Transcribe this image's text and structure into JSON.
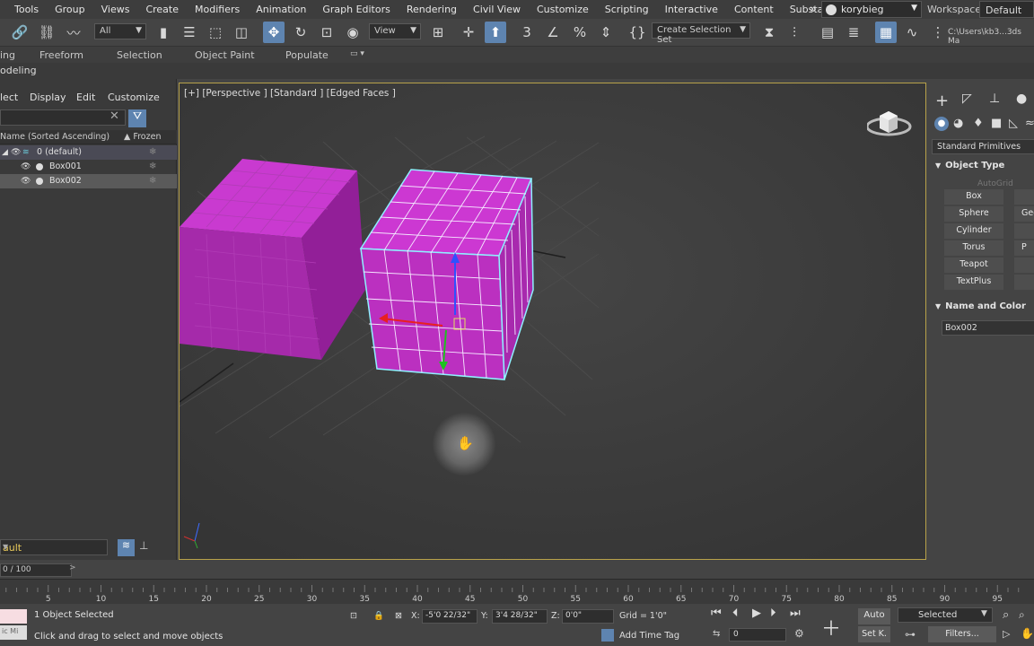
{
  "menubar": {
    "items": [
      "Tools",
      "Group",
      "Views",
      "Create",
      "Modifiers",
      "Animation",
      "Graph Editors",
      "Rendering",
      "Civil View",
      "Customize",
      "Scripting",
      "Interactive",
      "Content",
      "Substance"
    ],
    "more": "»",
    "user": "korybieg",
    "workspaces_label": "Workspaces:",
    "workspace_value": "Default"
  },
  "toolbar": {
    "selection_filter": "All",
    "ref_coord": "View",
    "selection_set": "Create Selection Set",
    "path": "C:\\Users\\kb3...3ds Ma"
  },
  "ribbon": {
    "tabs": [
      "ing",
      "Freeform",
      "Selection",
      "Object Paint",
      "Populate"
    ]
  },
  "modeling_bar": "odeling",
  "scene_explorer": {
    "menu": [
      "lect",
      "Display",
      "Edit",
      "Customize"
    ],
    "col_name": "Name (Sorted Ascending)",
    "col_frozen": "▲ Frozen",
    "rows": [
      {
        "name": "0 (default)"
      },
      {
        "name": "Box001"
      },
      {
        "name": "Box002"
      }
    ],
    "layer": "ault"
  },
  "viewport": {
    "label": "[+] [Perspective ] [Standard ] [Edged Faces ]"
  },
  "command_panel": {
    "category": "Standard Primitives",
    "object_type_title": "Object Type",
    "autogrid": "AutoGrid",
    "buttons": [
      "Box",
      "Sphere",
      "Cylinder",
      "Torus",
      "Teapot",
      "TextPlus"
    ],
    "buttons_right": [
      "",
      "Geo",
      "",
      "P",
      "",
      ""
    ],
    "name_color_title": "Name and Color",
    "name_value": "Box002"
  },
  "timeline": {
    "frame": "0 / 100",
    "ticks": [
      "5",
      "10",
      "15",
      "20",
      "25",
      "30",
      "35",
      "40",
      "45",
      "50",
      "55",
      "60",
      "65",
      "70",
      "75",
      "80",
      "85",
      "90",
      "95"
    ]
  },
  "status": {
    "selected": "1 Object Selected",
    "hint": "Click and drag to select and move objects",
    "mini": "ic Mi",
    "x_label": "X:",
    "x": "-5'0 22/32\"",
    "y_label": "Y:",
    "y": "3'4 28/32\"",
    "z_label": "Z:",
    "z": "0'0\"",
    "grid": "Grid = 1'0\"",
    "add_time_tag": "Add Time Tag",
    "auto": "Auto",
    "setk": "Set K.",
    "selected_dd": "Selected",
    "filters": "Filters...",
    "frame_field": "0"
  }
}
